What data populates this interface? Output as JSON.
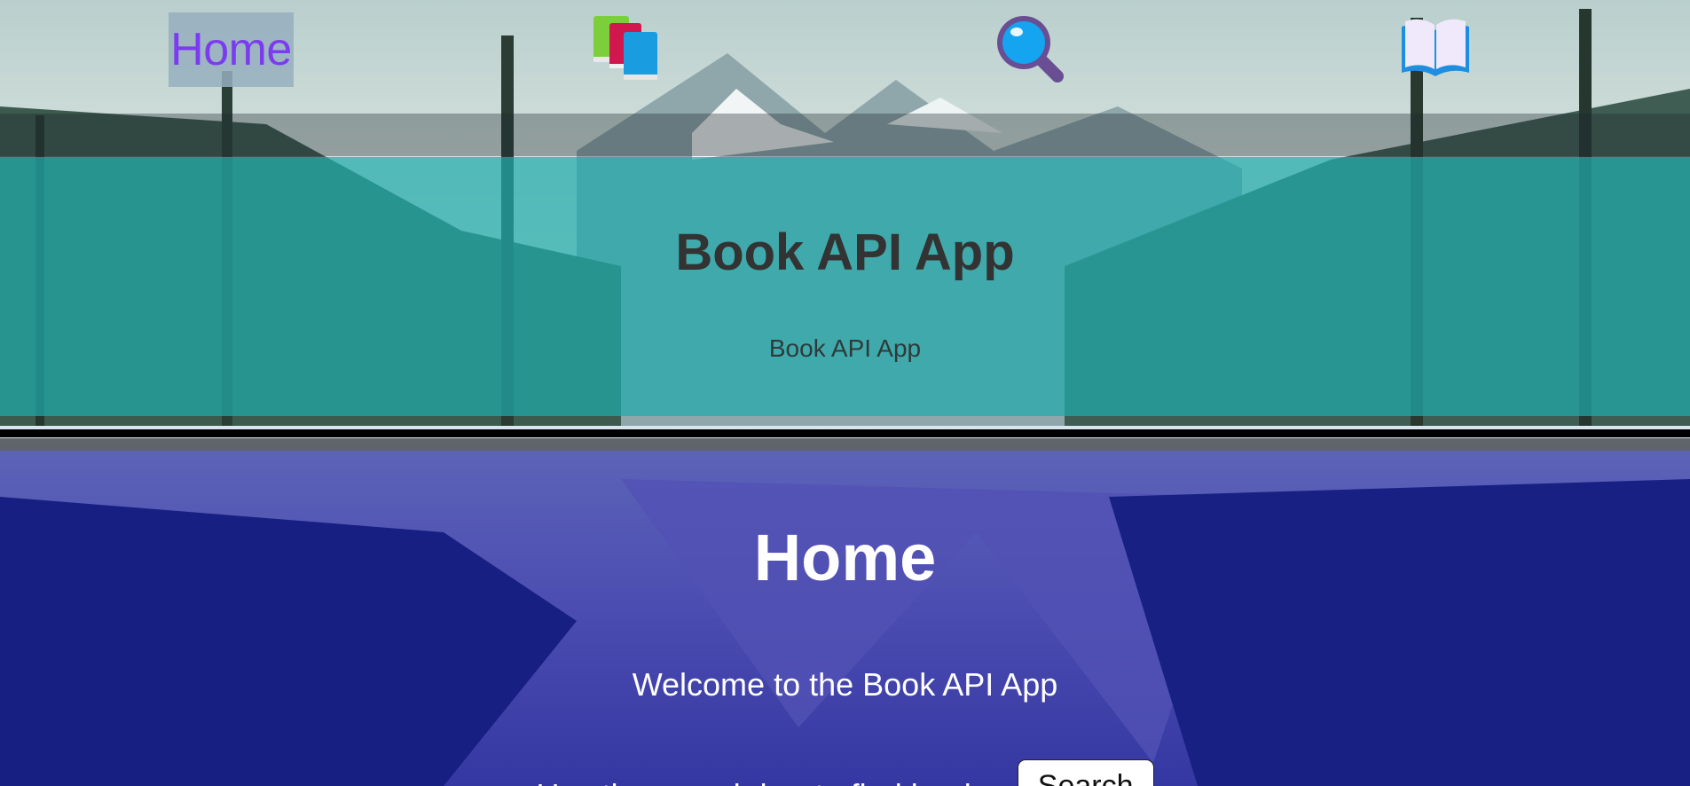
{
  "nav": {
    "home_label": "Home",
    "books_icon": "books-stack-icon",
    "search_icon": "magnifying-glass-icon",
    "open_book_icon": "open-book-icon",
    "home_color": "#7b3cf0"
  },
  "header": {
    "title": "Book API App",
    "subtitle": "Book API App",
    "band_color": "#20aaaa"
  },
  "main": {
    "title": "Home",
    "welcome": "Welcome to the Book API App",
    "search_prompt": "Use the search bar to find books:",
    "search_button": "Search",
    "band_color": "#141996"
  }
}
